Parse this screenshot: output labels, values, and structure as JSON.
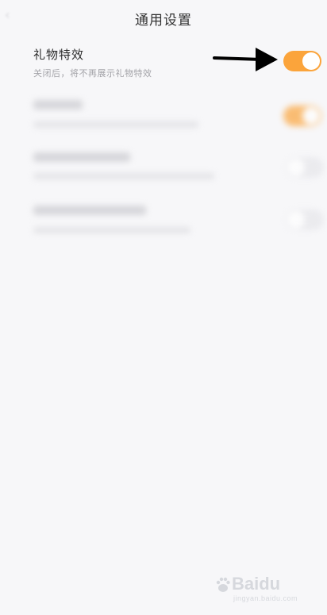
{
  "header": {
    "title": "通用设置",
    "back_icon": "chevron-left-icon"
  },
  "settings": {
    "gift_effects": {
      "title": "礼物特效",
      "subtitle": "关闭后，将不再展示礼物特效",
      "enabled": true
    },
    "blurred_rows": [
      {
        "enabled": true
      },
      {
        "enabled": false
      },
      {
        "enabled": false
      }
    ]
  },
  "colors": {
    "accent": "#fba43b",
    "background": "#f7f7f9"
  },
  "watermark": {
    "brand": "Baidu",
    "sub": "jingyan.baidu.com"
  }
}
